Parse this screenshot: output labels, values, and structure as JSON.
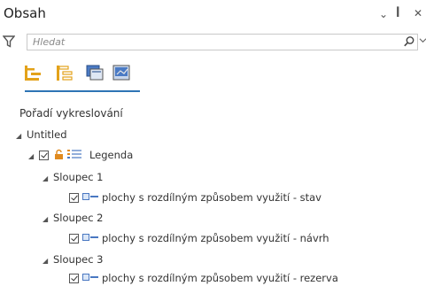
{
  "pane": {
    "title": "Obsah",
    "menu_glyph": "⌄",
    "pin_glyph": "ꟾ",
    "close_glyph": "✕"
  },
  "search": {
    "placeholder": "Hledat"
  },
  "view_tabs": [
    {
      "icon": "list-by-drawing-order-icon",
      "selected": true
    },
    {
      "icon": "list-by-source-icon",
      "selected": false
    },
    {
      "icon": "list-by-selection-icon",
      "selected": false
    },
    {
      "icon": "list-by-editing-icon",
      "selected": false
    }
  ],
  "section_title": "Pořadí vykreslování",
  "tree": {
    "map": "Untitled",
    "layout_element": "Legenda",
    "columns": [
      {
        "name": "Sloupec 1",
        "item": "plochy s rozdílným způsobem využití - stav"
      },
      {
        "name": "Sloupec 2",
        "item": "plochy s rozdílným způsobem využití - návrh"
      },
      {
        "name": "Sloupec 3",
        "item": "plochy s rozdílným způsobem využití - rezerva"
      }
    ]
  },
  "colors": {
    "accent": "#2e74b5",
    "legend_symbol": "#4a78c2",
    "lock": "#e08a1e"
  }
}
